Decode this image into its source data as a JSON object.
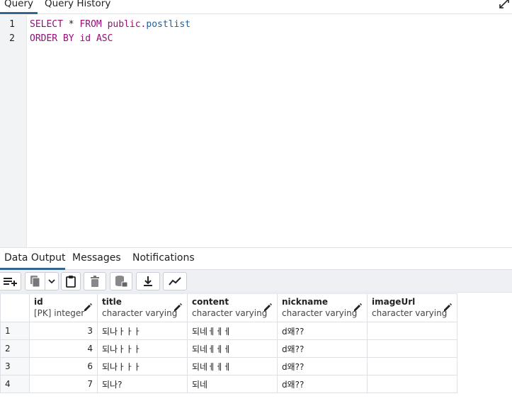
{
  "query_tabs": [
    {
      "label": "Query"
    },
    {
      "label": "Query History"
    }
  ],
  "editor": {
    "lines": [
      {
        "number": "1",
        "tokens": [
          "SELECT",
          " * ",
          "FROM",
          " public.",
          "postlist"
        ]
      },
      {
        "number": "2",
        "tokens": [
          "ORDER BY",
          " id ",
          "ASC"
        ]
      }
    ]
  },
  "output_tabs": [
    {
      "label": "Data Output"
    },
    {
      "label": "Messages"
    },
    {
      "label": "Notifications"
    }
  ],
  "toolbar": {
    "icons": [
      "add-row-icon",
      "copy-icon",
      "chevron-down-icon",
      "paste-icon",
      "delete-icon",
      "save-data-icon",
      "download-icon",
      "graph-icon"
    ]
  },
  "grid": {
    "columns": [
      {
        "name": "id",
        "type": "[PK] integer"
      },
      {
        "name": "title",
        "type": "character varying"
      },
      {
        "name": "content",
        "type": "character varying"
      },
      {
        "name": "nickname",
        "type": "character varying"
      },
      {
        "name": "imageUrl",
        "type": "character varying"
      }
    ],
    "rows": [
      {
        "num": "1",
        "id": "3",
        "title": "되나ㅏㅏㅏ",
        "content": "되네ㅔㅔㅔ",
        "nickname": "d왜??",
        "imageUrl": ""
      },
      {
        "num": "2",
        "id": "4",
        "title": "되나ㅏㅏㅏ",
        "content": "되네ㅔㅔㅔ",
        "nickname": "d왜??",
        "imageUrl": ""
      },
      {
        "num": "3",
        "id": "6",
        "title": "되나ㅏㅏㅏ",
        "content": "되네ㅔㅔㅔ",
        "nickname": "d왜??",
        "imageUrl": ""
      },
      {
        "num": "4",
        "id": "7",
        "title": "되나?",
        "content": "되네",
        "nickname": "d왜??",
        "imageUrl": ""
      }
    ]
  },
  "colors": {
    "accent": "#326690",
    "keyword": "#990b7c",
    "identifier": "#1f5f99"
  }
}
